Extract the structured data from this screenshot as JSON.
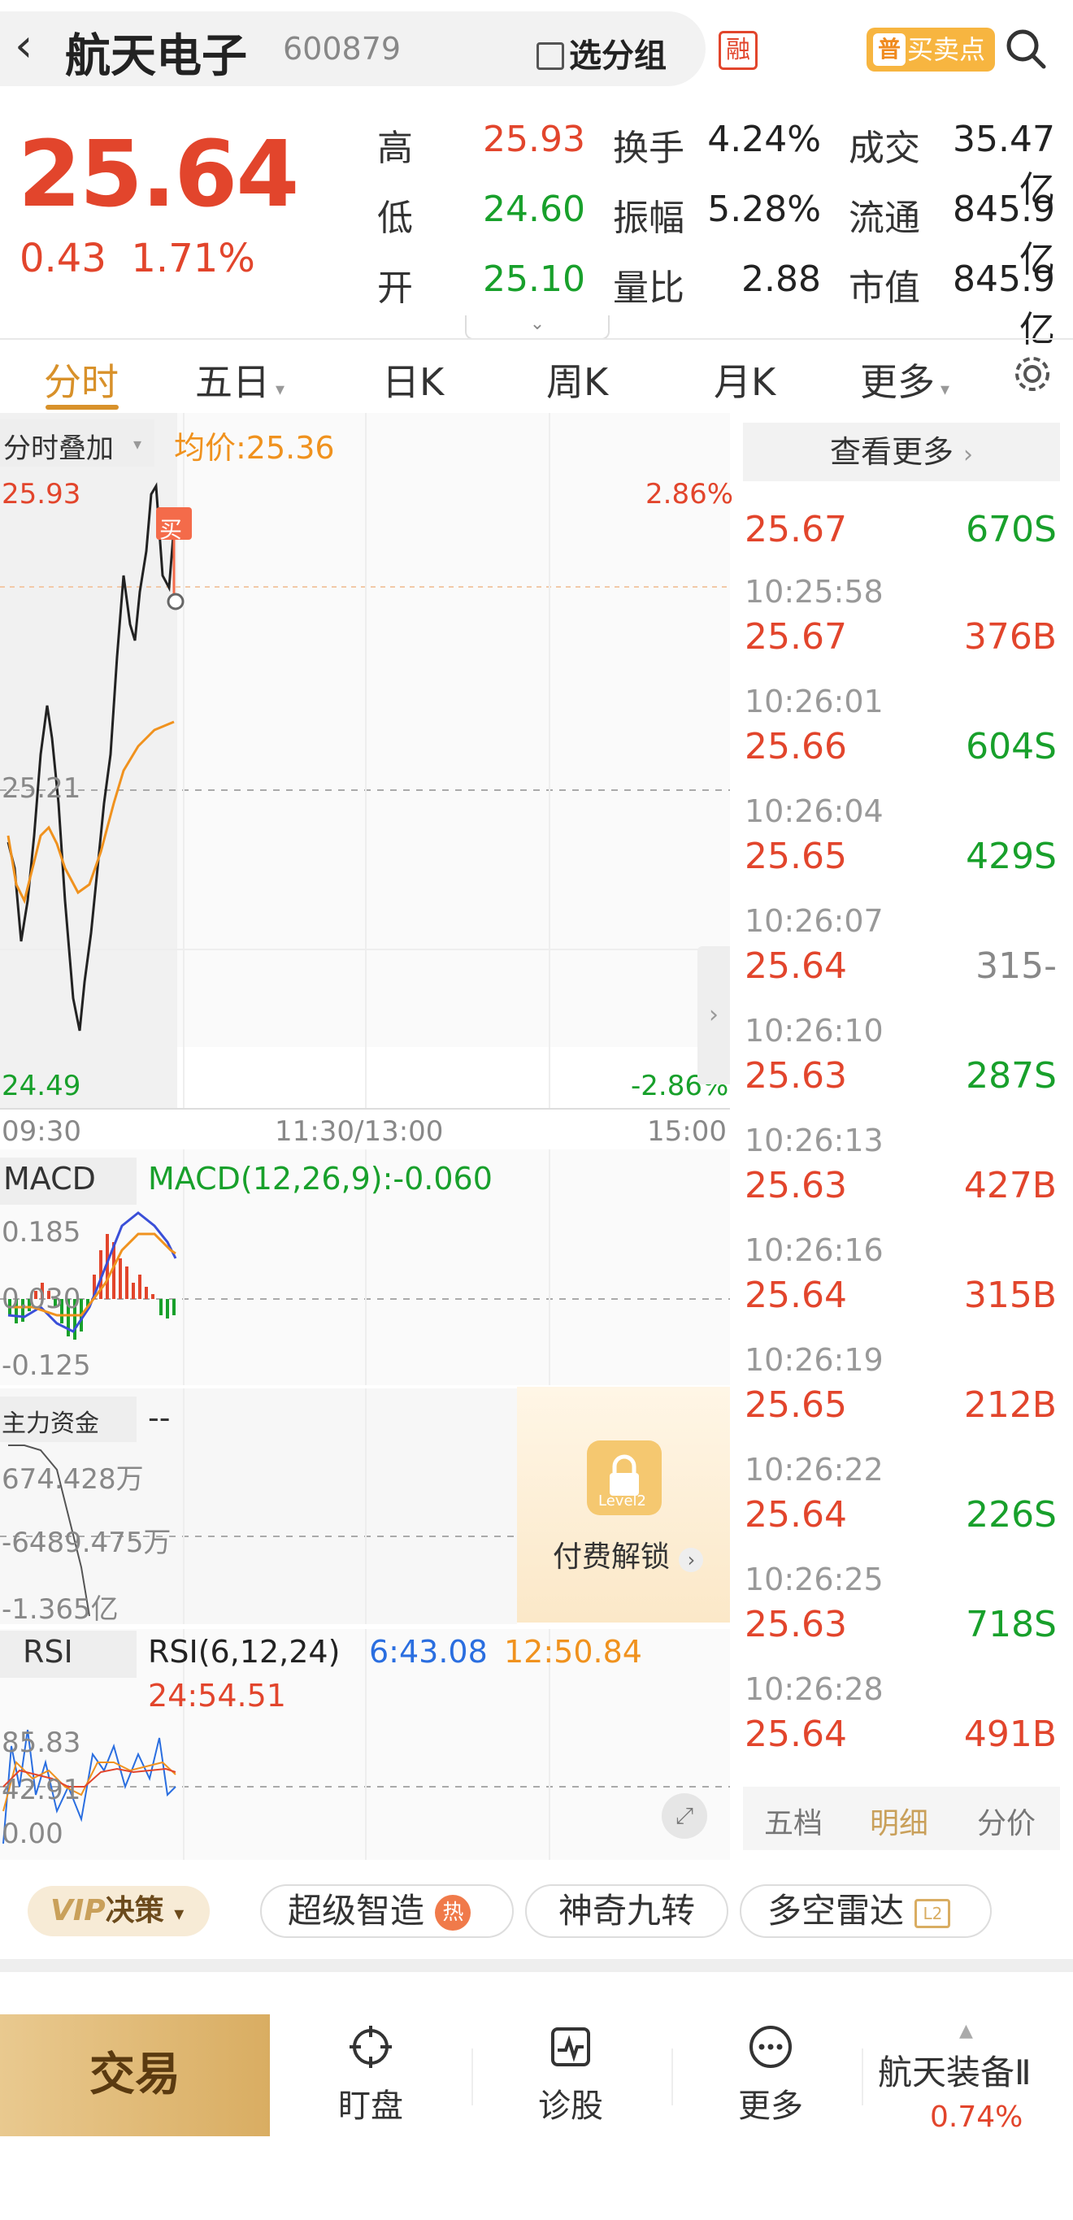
{
  "header": {
    "title": "航天电子",
    "code": "600879",
    "group_label": "选分组",
    "rong_label": "融",
    "pu_label": "普",
    "bs_label": "买卖点"
  },
  "quote": {
    "price": "25.64",
    "change": "0.43",
    "change_pct": "1.71%",
    "high_label": "高",
    "high": "25.93",
    "low_label": "低",
    "low": "24.60",
    "open_label": "开",
    "open": "25.10",
    "turnover_label": "换手",
    "turnover": "4.24%",
    "amplitude_label": "振幅",
    "amplitude": "5.28%",
    "vol_ratio_label": "量比",
    "vol_ratio": "2.88",
    "amount_label": "成交",
    "amount": "35.47亿",
    "float_label": "流通",
    "float_cap": "845.9亿",
    "mktcap_label": "市值",
    "mkt_cap": "845.9亿"
  },
  "tabs": [
    "分时",
    "五日",
    "日K",
    "周K",
    "月K",
    "更多"
  ],
  "chart": {
    "overlay_label": "分时叠加",
    "avg_label": "均价:25.36",
    "top_price": "25.93",
    "mid_price": "25.21",
    "bottom_price": "24.49",
    "top_pct": "2.86%",
    "bottom_pct": "-2.86%",
    "buy_marker": "买",
    "time_start": "09:30",
    "time_mid": "11:30/13:00",
    "time_end": "15:00"
  },
  "macd": {
    "label": "MACD",
    "value_label": "MACD(12,26,9):-0.060",
    "top": "0.185",
    "mid": "0.030",
    "bottom": "-0.125"
  },
  "capital": {
    "label": "主力资金",
    "value": "--",
    "top": "674.428万",
    "mid": "-6489.475万",
    "bottom": "-1.365亿",
    "lock_text": "付费解锁",
    "lock_badge": "Level2"
  },
  "rsi": {
    "label": "RSI",
    "title": "RSI(6,12,24)",
    "r6": "6:43.08",
    "r12": "12:50.84",
    "r24": "24:54.51",
    "top": "85.83",
    "mid": "42.91",
    "bottom": "0.00"
  },
  "trades": {
    "see_more": "查看更多",
    "rows": [
      {
        "time": "10:25:58",
        "price": "25.67",
        "vol": "376B",
        "dir": "up"
      },
      {
        "time": "10:26:01",
        "price": "25.66",
        "vol": "604S",
        "dir": "down"
      },
      {
        "time": "10:26:04",
        "price": "25.65",
        "vol": "429S",
        "dir": "down"
      },
      {
        "time": "10:26:07",
        "price": "25.64",
        "vol": "315-",
        "dir": "flat"
      },
      {
        "time": "10:26:10",
        "price": "25.63",
        "vol": "287S",
        "dir": "down"
      },
      {
        "time": "10:26:13",
        "price": "25.63",
        "vol": "427B",
        "dir": "up"
      },
      {
        "time": "10:26:16",
        "price": "25.64",
        "vol": "315B",
        "dir": "up"
      },
      {
        "time": "10:26:19",
        "price": "25.65",
        "vol": "212B",
        "dir": "up"
      },
      {
        "time": "10:26:22",
        "price": "25.64",
        "vol": "226S",
        "dir": "down"
      },
      {
        "time": "10:26:25",
        "price": "25.63",
        "vol": "718S",
        "dir": "down"
      },
      {
        "time": "10:26:28",
        "price": "25.64",
        "vol": "491B",
        "dir": "up"
      }
    ],
    "first_price": "25.67",
    "first_vol": "670S",
    "side_tabs": [
      "五档",
      "明细",
      "分价"
    ]
  },
  "features": {
    "vip": "决策",
    "chips": [
      "超级智造",
      "神奇九转",
      "多空雷达"
    ],
    "hot_badge": "热"
  },
  "bottom_nav": {
    "trade": "交易",
    "items": [
      "盯盘",
      "诊股",
      "更多"
    ],
    "sector": "航天装备Ⅱ",
    "sector_change": "0.74%"
  },
  "colors": {
    "up": "#e2452c",
    "down": "#18a02b",
    "accent": "#d8912a"
  }
}
